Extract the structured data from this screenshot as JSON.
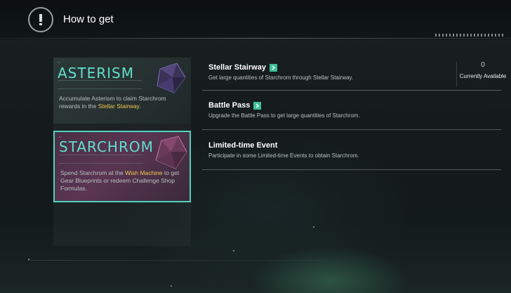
{
  "header": {
    "back_icon": "exclamation-icon",
    "title": "How to get"
  },
  "cards": [
    {
      "title": "ASTERISM",
      "description_pre": "Accumulate Asterism to claim Starchrom rewards in the ",
      "description_highlight": "Stellar Stairway",
      "description_post": ".",
      "selected": false
    },
    {
      "title": "STARCHROM",
      "description_pre": "Spend Starchrom at the ",
      "description_highlight": "Wish Machine",
      "description_post": " to get Gear Blueprints or redeem Challenge Shop Formulas.",
      "selected": true
    }
  ],
  "sources": [
    {
      "title": "Stellar Stairway",
      "description": "Get large quantities of Starchrom through Stellar Stairway.",
      "has_goto": true,
      "count": "0",
      "count_label": "Currently Available"
    },
    {
      "title": "Battle Pass",
      "description": "Upgrade the Battle Pass to get large quantities of Starchrom.",
      "has_goto": true
    },
    {
      "title": "Limited-time Event",
      "description": "Participate in some Limited-time Events to obtain Starchrom.",
      "has_goto": false
    }
  ],
  "colors": {
    "accent_teal": "#5fe0cc",
    "highlight_gold": "#f0c850",
    "goto_green": "#3fbf9a"
  }
}
